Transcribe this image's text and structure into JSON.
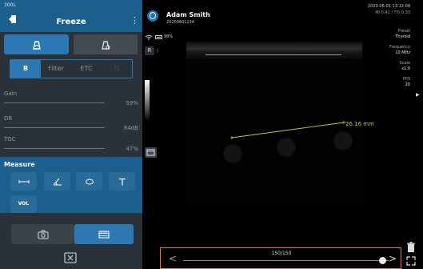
{
  "header": {
    "model": "300L",
    "title": "Freeze",
    "kebab": "⋮"
  },
  "tabs": [
    {
      "label": "B",
      "state": "active"
    },
    {
      "label": "Filter",
      "state": "normal"
    },
    {
      "label": "ETC",
      "state": "normal"
    },
    {
      "label": "TL",
      "state": "dim"
    }
  ],
  "sliders": {
    "gain": {
      "label": "Gain",
      "value": "59%"
    },
    "dr": {
      "label": "DR",
      "value": "84dB"
    },
    "tgc": {
      "label": "TGC",
      "value": "47%"
    }
  },
  "measure": {
    "title": "Measure",
    "vol_label": "VOL",
    "tools": [
      "distance-icon",
      "angle-icon",
      "ellipse-icon",
      "text-icon"
    ]
  },
  "patient": {
    "name": "Adam Smith",
    "id": "20200801234"
  },
  "status": {
    "battery": "98%",
    "r_label": "R",
    "r_chevron": "⟩"
  },
  "info": {
    "datetime": "2023-06-01 13:12:08",
    "mi_ti": "MI 0.42 / TIS 0.33"
  },
  "params": [
    {
      "label": "Preset",
      "value": "Thyroid"
    },
    {
      "label": "Frequency",
      "value": "10 MHz"
    },
    {
      "label": "Scale",
      "value": "x1.0"
    },
    {
      "label": "FPS",
      "value": "20"
    }
  ],
  "measurement": {
    "label": "26.16 mm"
  },
  "cine": {
    "counter": "150/150",
    "prev": "<",
    "next": ">",
    "position": 1.0
  },
  "right_arrow": "▶",
  "colors": {
    "accent": "#2d78b3",
    "header": "#1b5f8c",
    "panel": "#2b3138",
    "measure_line": "#c4c93a",
    "cine_border": "#e87a2a"
  }
}
